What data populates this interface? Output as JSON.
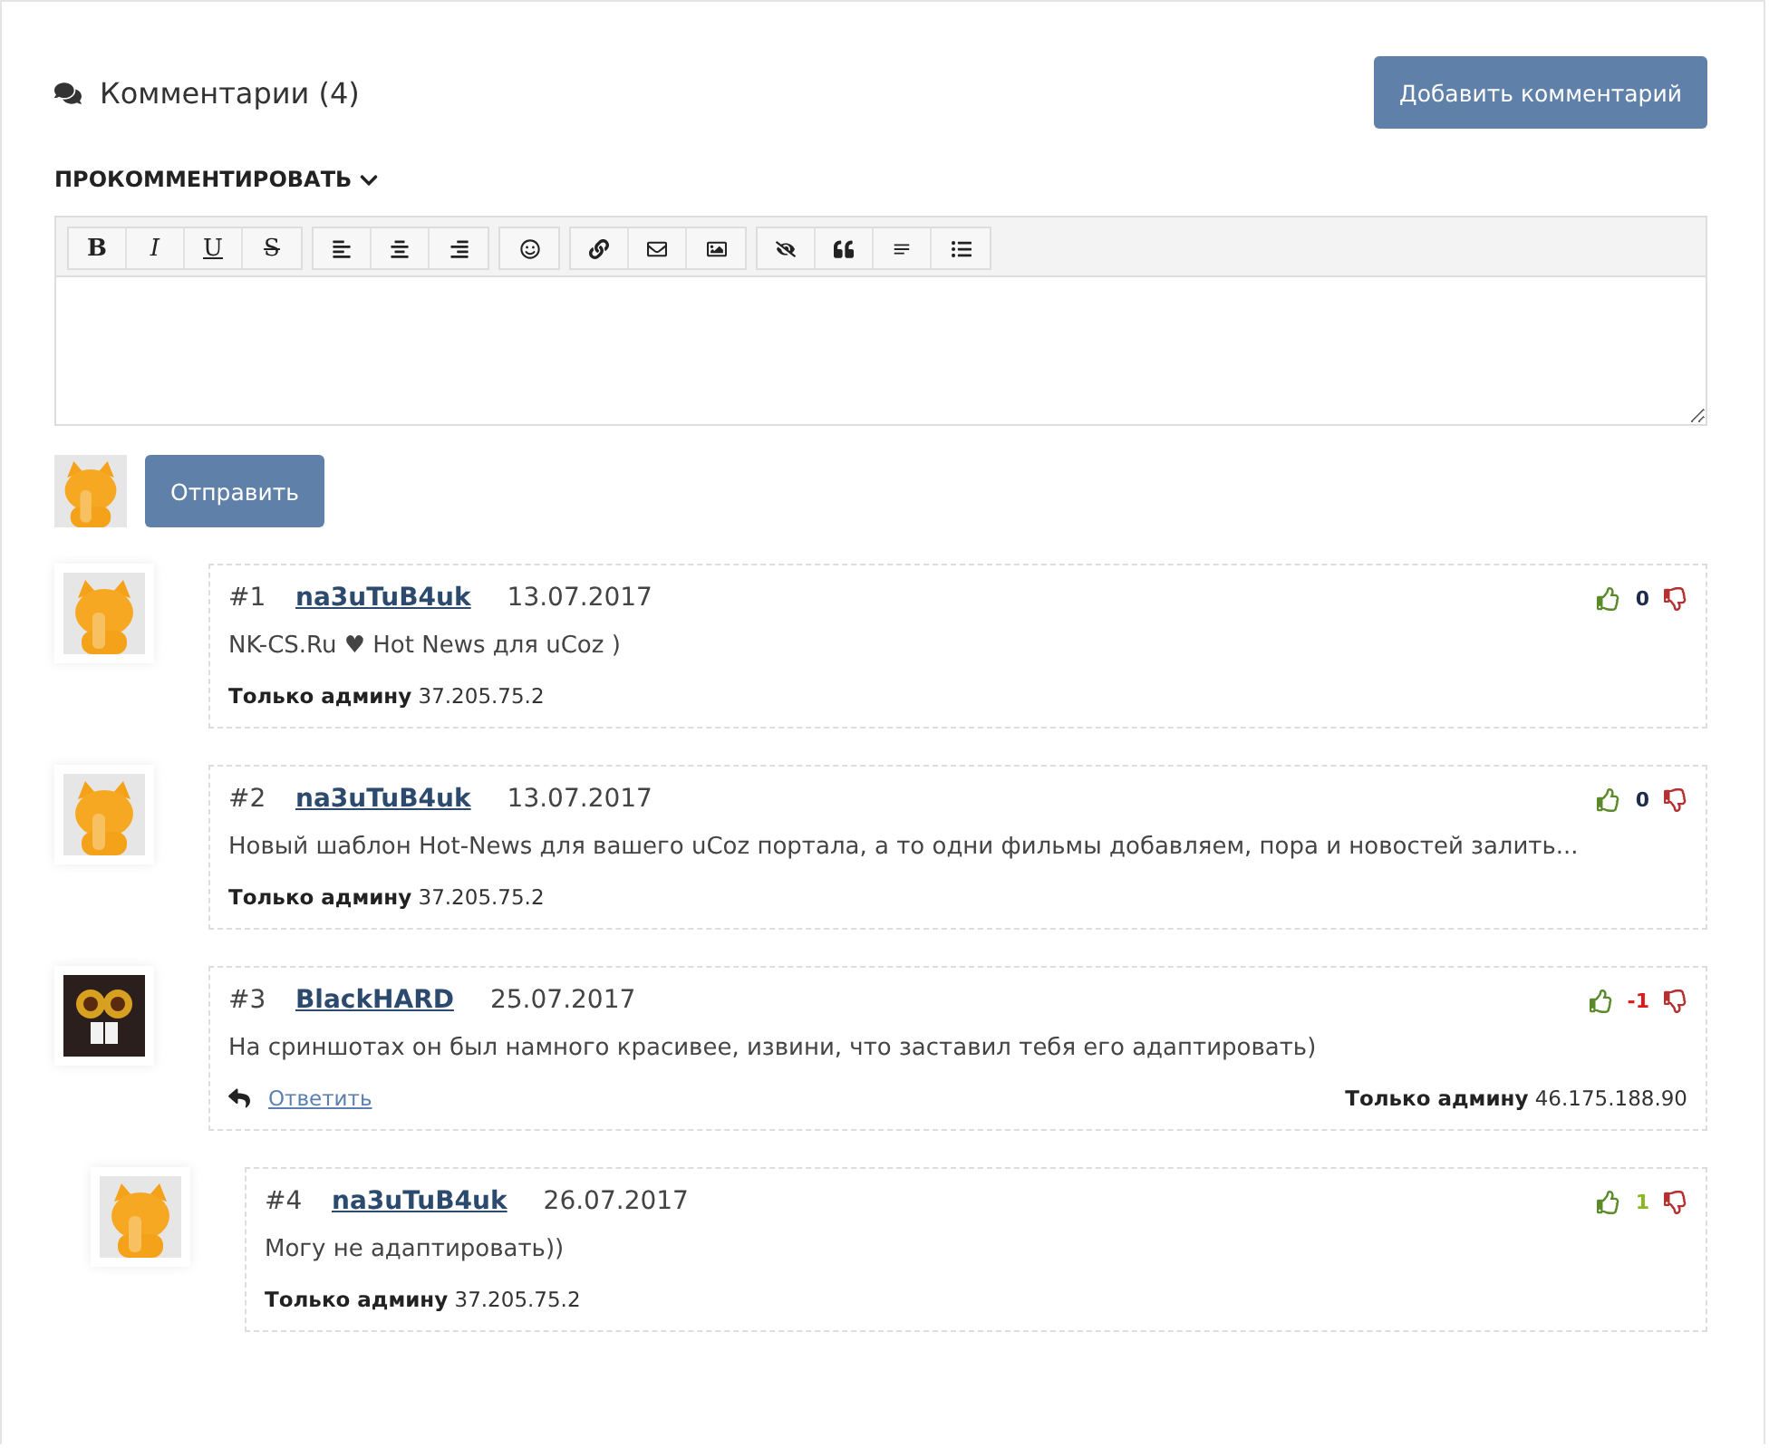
{
  "header": {
    "title": "Комментарии (4)",
    "add_button": "Добавить комментарий"
  },
  "form": {
    "toggle_label": "ПРОКОММЕНТИРОВАТЬ",
    "expanded": true,
    "letter_buttons": [
      "B",
      "I",
      "U",
      "S"
    ],
    "submit": "Отправить"
  },
  "comments": [
    {
      "kind": "cat",
      "number": "#1",
      "author": "na3uTuB4uk",
      "date": "13.07.2017",
      "text": "NK-CS.Ru ♥ Hot News для uCoz )",
      "rating": "0",
      "color": "#1d2a4a",
      "admin_label": "Только админу",
      "ip": "37.205.75.2"
    },
    {
      "kind": "cat",
      "number": "#2",
      "author": "na3uTuB4uk",
      "date": "13.07.2017",
      "text": "Новый шаблон Hot-News для вашего uCoz портала, а то одни фильмы добавляем, пора и новостей залить...",
      "rating": "0",
      "color": "#1d2a4a",
      "admin_label": "Только админу",
      "ip": "37.205.75.2"
    },
    {
      "kind": "dark",
      "number": "#3",
      "author": "BlackHARD",
      "date": "25.07.2017",
      "text": "На сриншотах он был намного красивее, извини, что заставил тебя его адаптировать)",
      "rating": "-1",
      "color": "#e01818",
      "reply": "Ответить",
      "admin_label": "Только админу",
      "ip": "46.175.188.90",
      "children": [
        {
          "kind": "cat",
          "number": "#4",
          "author": "na3uTuB4uk",
          "date": "26.07.2017",
          "text": "Могу не адаптировать))",
          "rating": "1",
          "color": "#8ab622",
          "admin_label": "Только админу",
          "ip": "37.205.75.2"
        }
      ]
    }
  ]
}
